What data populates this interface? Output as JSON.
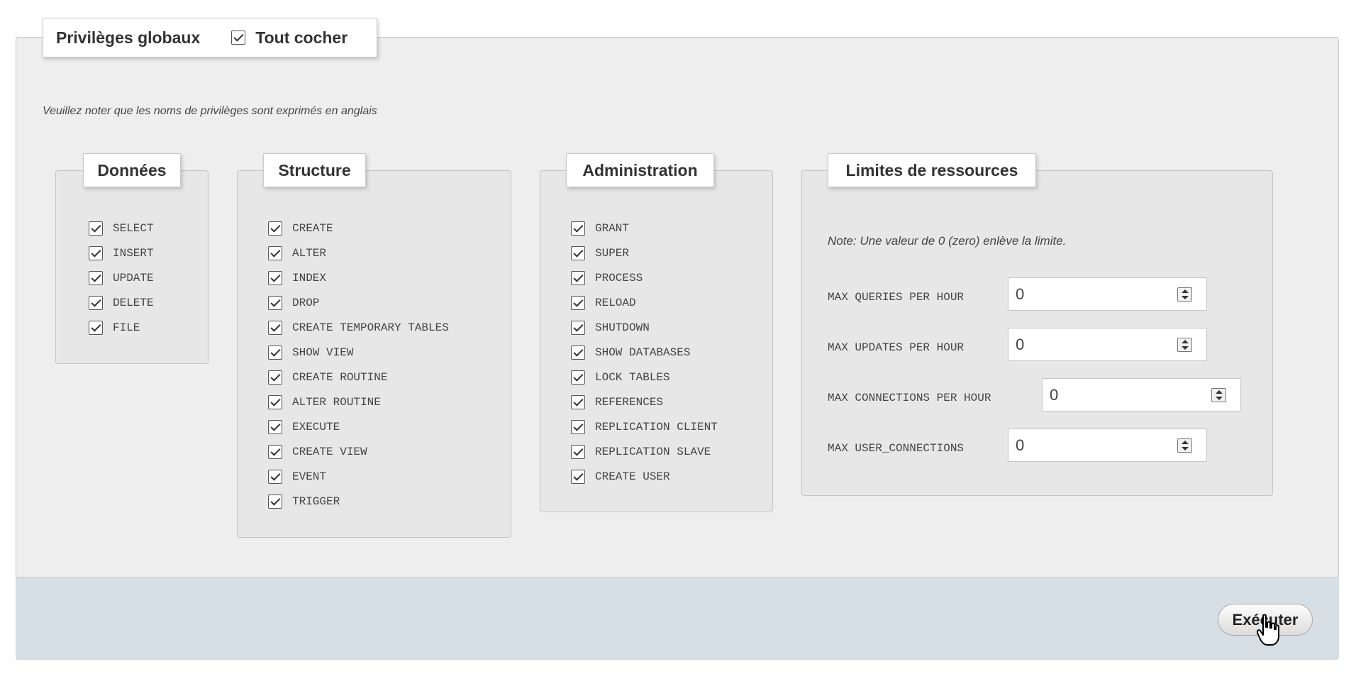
{
  "fieldset": {
    "title": "Privilèges globaux",
    "check_all_label": "Tout cocher",
    "note": "Veuillez noter que les noms de privilèges sont exprimés en anglais"
  },
  "groups": {
    "data": {
      "title": "Données",
      "items": [
        "SELECT",
        "INSERT",
        "UPDATE",
        "DELETE",
        "FILE"
      ]
    },
    "structure": {
      "title": "Structure",
      "items": [
        "CREATE",
        "ALTER",
        "INDEX",
        "DROP",
        "CREATE TEMPORARY TABLES",
        "SHOW VIEW",
        "CREATE ROUTINE",
        "ALTER ROUTINE",
        "EXECUTE",
        "CREATE VIEW",
        "EVENT",
        "TRIGGER"
      ]
    },
    "administration": {
      "title": "Administration",
      "items": [
        "GRANT",
        "SUPER",
        "PROCESS",
        "RELOAD",
        "SHUTDOWN",
        "SHOW DATABASES",
        "LOCK TABLES",
        "REFERENCES",
        "REPLICATION CLIENT",
        "REPLICATION SLAVE",
        "CREATE USER"
      ]
    }
  },
  "limits": {
    "title": "Limites de ressources",
    "note": "Note: Une valeur de 0 (zero) enlève la limite.",
    "fields": [
      {
        "label": "MAX QUERIES PER HOUR",
        "value": "0"
      },
      {
        "label": "MAX UPDATES PER HOUR",
        "value": "0"
      },
      {
        "label": "MAX CONNECTIONS PER HOUR",
        "value": "0"
      },
      {
        "label": "MAX USER_CONNECTIONS",
        "value": "0"
      }
    ]
  },
  "footer": {
    "submit_label": "Exécuter"
  },
  "icons": {
    "checkbox": "checkbox-checked-icon",
    "spinner": "spinner-updown-icon",
    "cursor": "hand-pointer-cursor-icon"
  }
}
